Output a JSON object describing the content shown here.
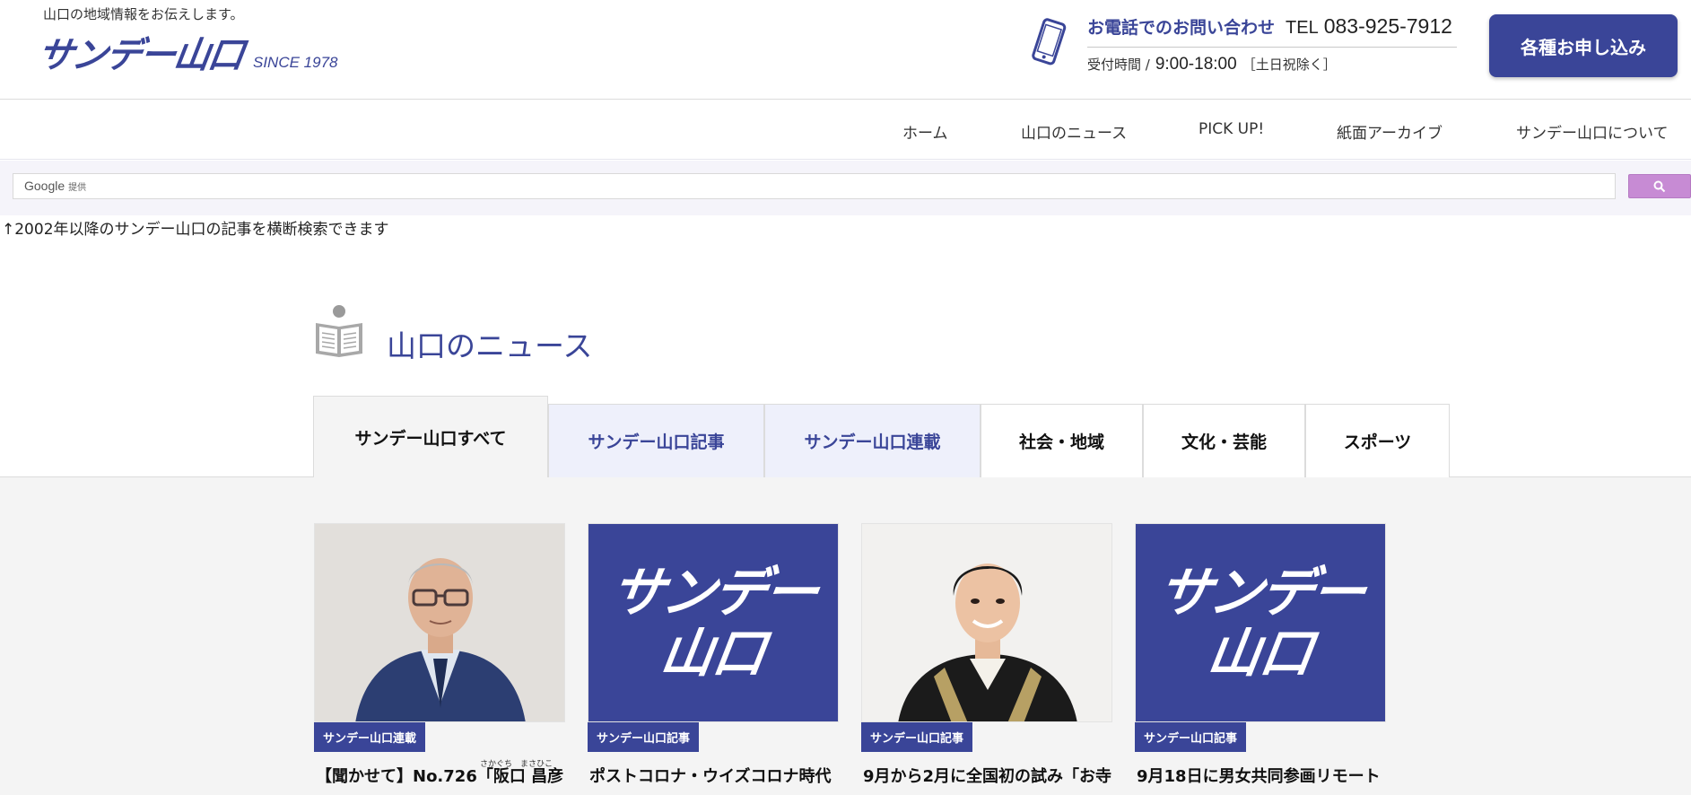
{
  "header": {
    "tagline": "山口の地域情報をお伝えします。",
    "logo_text": "サンデー山口",
    "logo_since": "SINCE 1978",
    "phone_label": "お電話でのお問い合わせ",
    "tel_label": "TEL",
    "tel_number": "083-925-7912",
    "hours_label": "受付時間 /",
    "hours_value": "9:00-18:00",
    "hours_note": "［土日祝除く］",
    "apply_label": "各種お申し込み"
  },
  "nav": {
    "items": [
      {
        "label": "ホーム"
      },
      {
        "label": "山口のニュース"
      },
      {
        "label": "PICK UP!"
      },
      {
        "label": "紙面アーカイブ"
      },
      {
        "label": "サンデー山口について"
      }
    ]
  },
  "search": {
    "brand": "Google",
    "brand_sub": "提供",
    "note": "↑2002年以降のサンデー山口の記事を横断検索できます"
  },
  "section": {
    "title": "山口のニュース"
  },
  "tabs": [
    {
      "label": "サンデー山口すべて"
    },
    {
      "label": "サンデー山口記事"
    },
    {
      "label": "サンデー山口連載"
    },
    {
      "label": "社会・地域"
    },
    {
      "label": "文化・芸能"
    },
    {
      "label": "スポーツ"
    }
  ],
  "cards": [
    {
      "badge": "サンデー山口連載",
      "title": "【聞かせて】No.726「阪口 昌彦",
      "ruby_1": "さかぐち",
      "ruby_2": "まさひこ",
      "thumb_logo_l1": "",
      "thumb_logo_l2": ""
    },
    {
      "badge": "サンデー山口記事",
      "title": "ポストコロナ・ウイズコロナ時代",
      "thumb_logo_l1": "サンデー",
      "thumb_logo_l2": "山口"
    },
    {
      "badge": "サンデー山口記事",
      "title": "9月から2月に全国初の試み「お寺",
      "thumb_logo_l1": "",
      "thumb_logo_l2": ""
    },
    {
      "badge": "サンデー山口記事",
      "title": "9月18日に男女共同参画リモート",
      "thumb_logo_l1": "サンデー",
      "thumb_logo_l2": "山口"
    }
  ],
  "colors": {
    "brand": "#3a4598",
    "search_button": "#c78bd4",
    "tab_blue_bg": "#eef0fb",
    "content_bg": "#f4f4f4"
  }
}
